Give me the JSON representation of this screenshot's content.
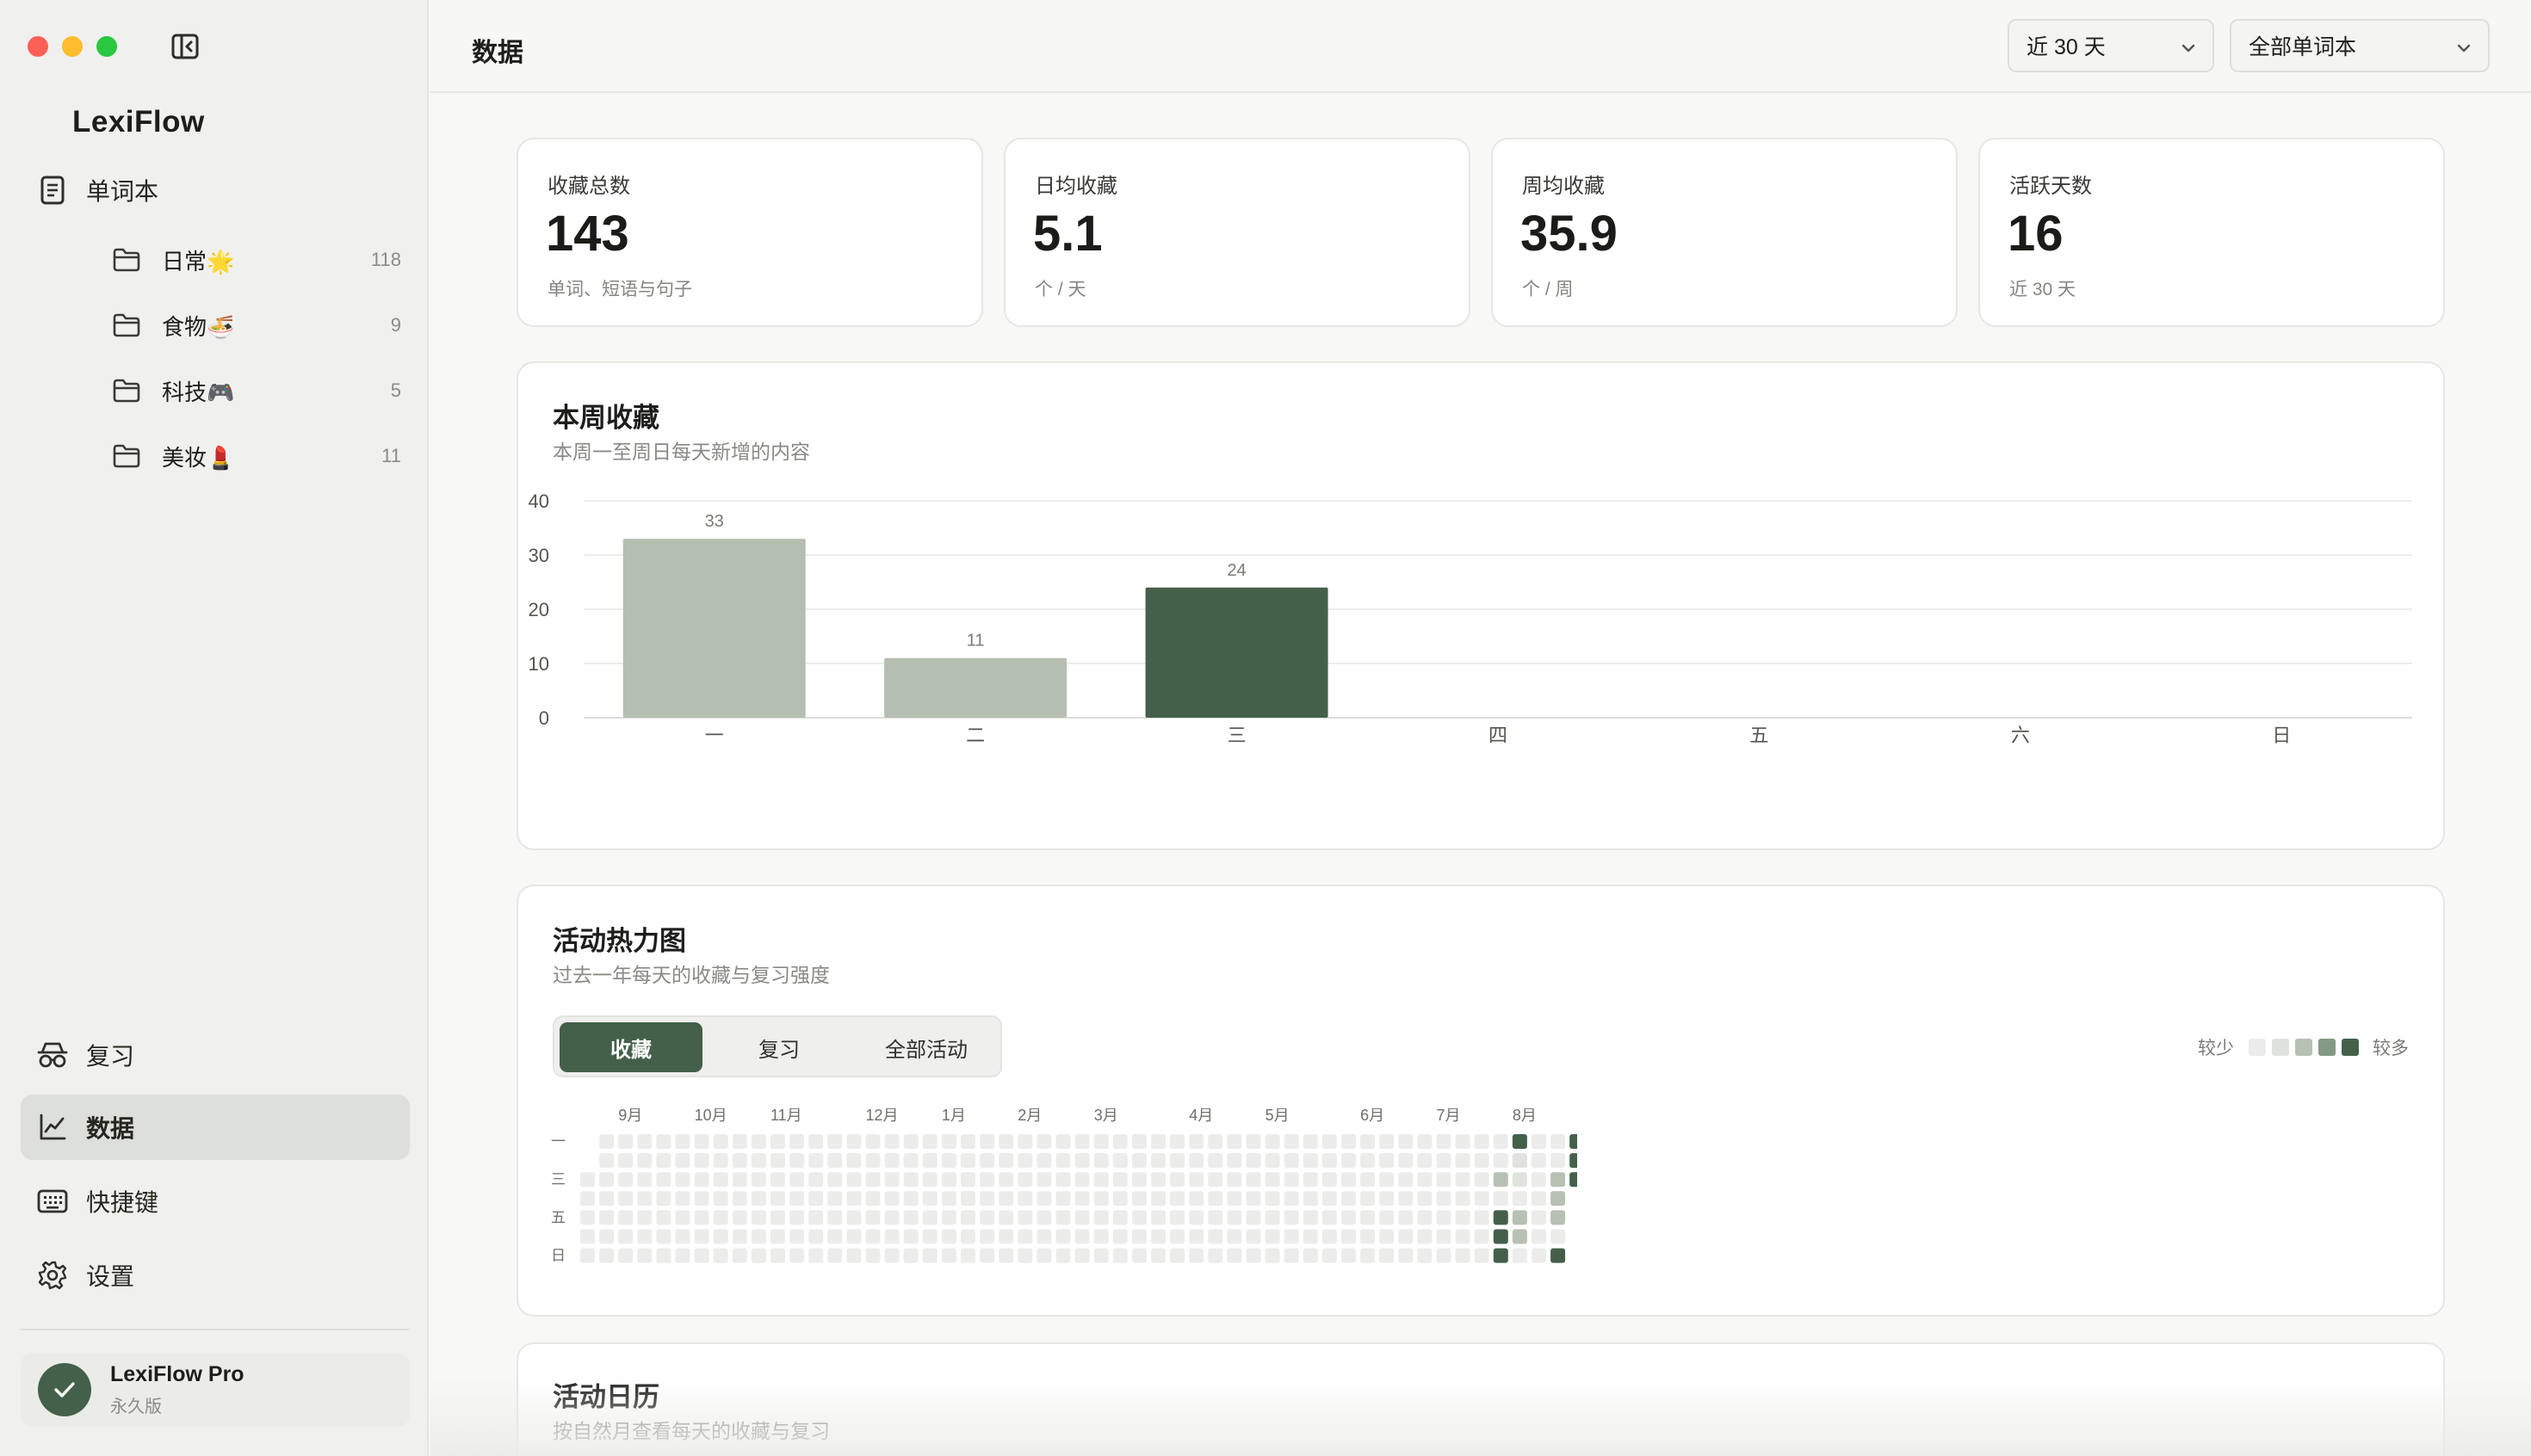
{
  "sidebar": {
    "app_name": "LexiFlow",
    "vocab_label": "单词本",
    "notebooks": [
      {
        "label": "日常🌟",
        "count": "118"
      },
      {
        "label": "食物🍜",
        "count": "9"
      },
      {
        "label": "科技🎮",
        "count": "5"
      },
      {
        "label": "美妆💄",
        "count": "11"
      }
    ],
    "nav": [
      {
        "label": "复习",
        "icon": "review-icon"
      },
      {
        "label": "数据",
        "icon": "chart-icon",
        "active": true
      },
      {
        "label": "快捷键",
        "icon": "keyboard-icon"
      },
      {
        "label": "设置",
        "icon": "gear-icon"
      }
    ],
    "pro": {
      "title": "LexiFlow Pro",
      "subtitle": "永久版"
    }
  },
  "header": {
    "title": "数据",
    "range_select": "近 30 天",
    "book_select": "全部单词本"
  },
  "stats": [
    {
      "label": "收藏总数",
      "value": "143",
      "sub": "单词、短语与句子"
    },
    {
      "label": "日均收藏",
      "value": "5.1",
      "sub": "个 / 天"
    },
    {
      "label": "周均收藏",
      "value": "35.9",
      "sub": "个 / 周"
    },
    {
      "label": "活跃天数",
      "value": "16",
      "sub": "近 30 天"
    }
  ],
  "weekly": {
    "title": "本周收藏",
    "subtitle": "本周一至周日每天新增的内容"
  },
  "chart_data": {
    "type": "bar",
    "title": "本周收藏",
    "subtitle": "本周一至周日每天新增的内容",
    "categories": [
      "一",
      "二",
      "三",
      "四",
      "五",
      "六",
      "日"
    ],
    "values": [
      33,
      11,
      24,
      0,
      0,
      0,
      0
    ],
    "highlight_index": 2,
    "ylim": [
      0,
      40
    ],
    "yticks": [
      0,
      10,
      20,
      30,
      40
    ],
    "grid": true,
    "colors": {
      "bar": "#b4bfb2",
      "highlight": "#44604a"
    }
  },
  "heatmap": {
    "title": "活动热力图",
    "subtitle": "过去一年每天的收藏与复习强度",
    "tabs": [
      "收藏",
      "复习",
      "全部活动"
    ],
    "active_tab": 0,
    "legend_less": "较少",
    "legend_more": "较多",
    "levels": [
      "#ececea",
      "#dfe3dd",
      "#b6c1b3",
      "#849a84",
      "#44604a"
    ],
    "months": [
      {
        "label": "9月",
        "week": 2
      },
      {
        "label": "10月",
        "week": 6
      },
      {
        "label": "11月",
        "week": 10
      },
      {
        "label": "12月",
        "week": 15
      },
      {
        "label": "1月",
        "week": 19
      },
      {
        "label": "2月",
        "week": 23
      },
      {
        "label": "3月",
        "week": 27
      },
      {
        "label": "4月",
        "week": 32
      },
      {
        "label": "5月",
        "week": 36
      },
      {
        "label": "6月",
        "week": 41
      },
      {
        "label": "7月",
        "week": 45
      },
      {
        "label": "8月",
        "week": 49
      }
    ],
    "day_labels": [
      "一",
      "",
      "三",
      "",
      "五",
      "",
      "日"
    ],
    "weeks": 53,
    "start_day": 2,
    "active_cells": [
      {
        "week": 48,
        "day": 2,
        "level": 2
      },
      {
        "week": 48,
        "day": 4,
        "level": 4
      },
      {
        "week": 48,
        "day": 5,
        "level": 4
      },
      {
        "week": 48,
        "day": 6,
        "level": 4
      },
      {
        "week": 49,
        "day": 0,
        "level": 4
      },
      {
        "week": 49,
        "day": 1,
        "level": 1
      },
      {
        "week": 49,
        "day": 2,
        "level": 1
      },
      {
        "week": 49,
        "day": 4,
        "level": 2
      },
      {
        "week": 49,
        "day": 5,
        "level": 2
      },
      {
        "week": 51,
        "day": 2,
        "level": 2
      },
      {
        "week": 51,
        "day": 3,
        "level": 2
      },
      {
        "week": 51,
        "day": 4,
        "level": 2
      },
      {
        "week": 51,
        "day": 6,
        "level": 4
      },
      {
        "week": 52,
        "day": 0,
        "level": 4
      },
      {
        "week": 52,
        "day": 1,
        "level": 4
      },
      {
        "week": 52,
        "day": 2,
        "level": 4
      }
    ]
  },
  "calendar": {
    "title": "活动日历",
    "subtitle": "按自然月查看每天的收藏与复习"
  }
}
